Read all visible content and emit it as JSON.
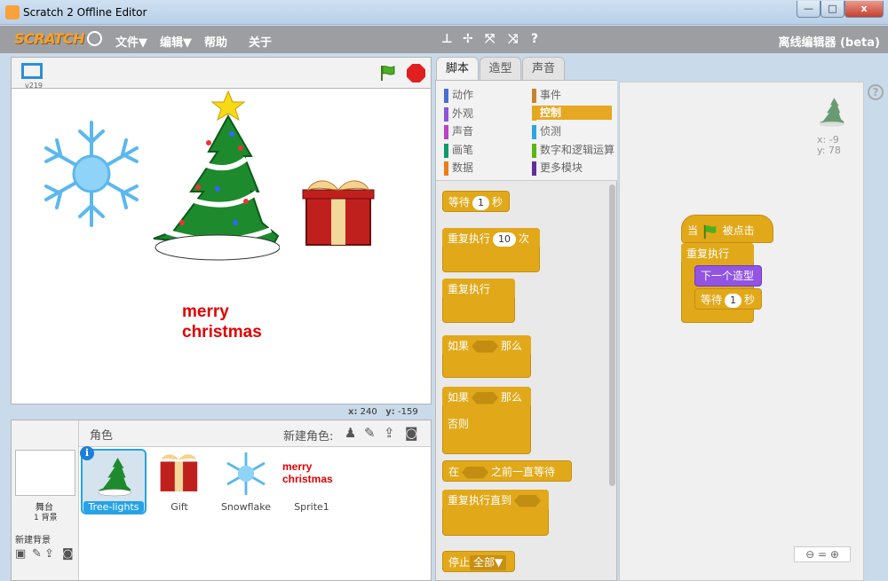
{
  "window": {
    "title": "Scratch 2 Offline Editor",
    "btn_min": "—",
    "btn_max": "□",
    "btn_close": "x"
  },
  "menu": {
    "logo": "SCRATCH",
    "file": "文件▼",
    "edit": "编辑▼",
    "help": "帮助",
    "about": "关于",
    "title_right": "离线编辑器 (beta)",
    "tools": [
      "⊥",
      "✢",
      "⤧",
      "⤨",
      "?"
    ]
  },
  "stage": {
    "version": "v219",
    "merry_line1": "merry",
    "merry_line2": "christmas",
    "mouse_x_label": "x:",
    "mouse_x": "240",
    "mouse_y_label": "y:",
    "mouse_y": "-159"
  },
  "sprites_panel": {
    "header": "角色",
    "new_sprite": "新建角色:",
    "stage_label": "舞台",
    "stage_backdrops": "1 背景",
    "new_backdrop": "新建背景",
    "items": [
      {
        "label": "Tree-lights"
      },
      {
        "label": "Gift"
      },
      {
        "label": "Snowflake"
      },
      {
        "label": "Sprite1"
      }
    ],
    "sprite1_line1": "merry",
    "sprite1_line2": "christmas"
  },
  "tabs": {
    "scripts": "脚本",
    "costumes": "造型",
    "sounds": "声音"
  },
  "categories": {
    "left": [
      {
        "label": "动作",
        "color": "#4a6cd4"
      },
      {
        "label": "外观",
        "color": "#8a55d7"
      },
      {
        "label": "声音",
        "color": "#bb42c3"
      },
      {
        "label": "画笔",
        "color": "#0e9a6c"
      },
      {
        "label": "数据",
        "color": "#ee7d16"
      }
    ],
    "right": [
      {
        "label": "事件",
        "color": "#c88330"
      },
      {
        "label": "控制",
        "color": "#e1a91a"
      },
      {
        "label": "侦测",
        "color": "#2ca5e2"
      },
      {
        "label": "数字和逻辑运算",
        "color": "#5cb712"
      },
      {
        "label": "更多模块",
        "color": "#632d99"
      }
    ]
  },
  "blocks": {
    "wait_prefix": "等待",
    "wait_value": "1",
    "wait_suffix": "秒",
    "repeat_prefix": "重复执行",
    "repeat_value": "10",
    "repeat_suffix": "次",
    "forever": "重复执行",
    "if_prefix": "如果",
    "if_then": "那么",
    "if2_prefix": "如果",
    "if2_then": "那么",
    "else": "否则",
    "wait_until_prefix": "在",
    "wait_until_suffix": "之前一直等待",
    "repeat_until": "重复执行直到",
    "stop_prefix": "停止",
    "stop_value": "全部▼"
  },
  "script_area": {
    "hat_prefix": "当",
    "hat_suffix": "被点击",
    "forever": "重复执行",
    "next_costume": "下一个造型",
    "wait_prefix": "等待",
    "wait_value": "1",
    "wait_suffix": "秒",
    "x_label": "x:",
    "x_value": "-9",
    "y_label": "y:",
    "y_value": "78",
    "zoom": "⊖ = ⊕"
  }
}
